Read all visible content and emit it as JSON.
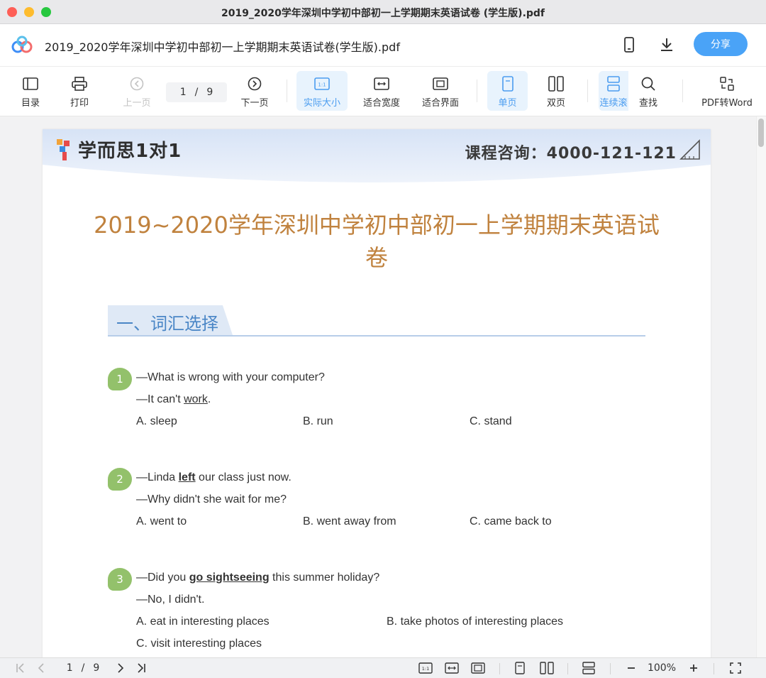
{
  "window": {
    "title": "2019_2020学年深圳中学初中部初一上学期期末英语试卷 (学生版).pdf"
  },
  "header": {
    "doc_name": "2019_2020学年深圳中学初中部初一上学期期末英语试卷(学生版).pdf",
    "share_label": "分享"
  },
  "toolbar": {
    "toc": "目录",
    "print": "打印",
    "prev": "上一页",
    "page_current": "1",
    "page_sep": "/",
    "page_total": "9",
    "next": "下一页",
    "actual_size": "实际大小",
    "fit_width": "适合宽度",
    "fit_page": "适合界面",
    "single": "单页",
    "double": "双页",
    "continuous": "连续滚",
    "search": "查找",
    "to_word": "PDF转Word"
  },
  "page": {
    "brand": "学而思1对1",
    "hotline": "课程咨询：4000-121-121",
    "title": "2019~2020学年深圳中学初中部初一上学期期末英语试卷",
    "section": "一、词汇选择"
  },
  "questions": [
    {
      "num": "1",
      "line1": {
        "pre": "—What is wrong with your computer?",
        "ul": "",
        "post": ""
      },
      "line2": {
        "pre": "—It can't ",
        "ul": "work",
        "post": "."
      },
      "options": [
        "A.  sleep",
        "B.  run",
        "C.  stand"
      ]
    },
    {
      "num": "2",
      "line1": {
        "pre": "—Linda ",
        "ul": "left",
        "post": " our class just now."
      },
      "line2": {
        "pre": "—Why didn't she wait for me?",
        "ul": "",
        "post": ""
      },
      "options": [
        "A.  went to",
        "B.  went away from",
        "C.  came back to"
      ]
    },
    {
      "num": "3",
      "line1": {
        "pre": "—Did you ",
        "ul": "go sightseeing",
        "post": " this summer holiday?"
      },
      "line2": {
        "pre": "—No, I didn't.",
        "ul": "",
        "post": ""
      },
      "options": [
        "A.  eat in interesting places",
        "B.  take photos of interesting places",
        "C.  visit interesting places"
      ]
    }
  ],
  "statusbar": {
    "page_current": "1",
    "page_sep": "/",
    "page_total": "9",
    "zoom": "100%"
  },
  "colors": {
    "accent": "#4aa3f7",
    "title": "#c0823e",
    "section": "#4a86c6",
    "badge": "#93c16b"
  }
}
